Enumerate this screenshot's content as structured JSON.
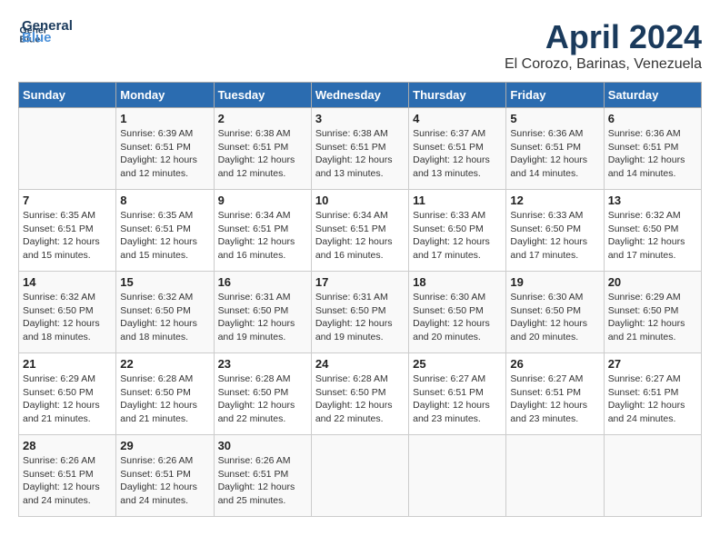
{
  "header": {
    "logo_line1": "General",
    "logo_line2": "Blue",
    "month_title": "April 2024",
    "location": "El Corozo, Barinas, Venezuela"
  },
  "weekdays": [
    "Sunday",
    "Monday",
    "Tuesday",
    "Wednesday",
    "Thursday",
    "Friday",
    "Saturday"
  ],
  "weeks": [
    [
      {
        "day": "",
        "sunrise": "",
        "sunset": "",
        "daylight": ""
      },
      {
        "day": "1",
        "sunrise": "Sunrise: 6:39 AM",
        "sunset": "Sunset: 6:51 PM",
        "daylight": "Daylight: 12 hours and 12 minutes."
      },
      {
        "day": "2",
        "sunrise": "Sunrise: 6:38 AM",
        "sunset": "Sunset: 6:51 PM",
        "daylight": "Daylight: 12 hours and 12 minutes."
      },
      {
        "day": "3",
        "sunrise": "Sunrise: 6:38 AM",
        "sunset": "Sunset: 6:51 PM",
        "daylight": "Daylight: 12 hours and 13 minutes."
      },
      {
        "day": "4",
        "sunrise": "Sunrise: 6:37 AM",
        "sunset": "Sunset: 6:51 PM",
        "daylight": "Daylight: 12 hours and 13 minutes."
      },
      {
        "day": "5",
        "sunrise": "Sunrise: 6:36 AM",
        "sunset": "Sunset: 6:51 PM",
        "daylight": "Daylight: 12 hours and 14 minutes."
      },
      {
        "day": "6",
        "sunrise": "Sunrise: 6:36 AM",
        "sunset": "Sunset: 6:51 PM",
        "daylight": "Daylight: 12 hours and 14 minutes."
      }
    ],
    [
      {
        "day": "7",
        "sunrise": "Sunrise: 6:35 AM",
        "sunset": "Sunset: 6:51 PM",
        "daylight": "Daylight: 12 hours and 15 minutes."
      },
      {
        "day": "8",
        "sunrise": "Sunrise: 6:35 AM",
        "sunset": "Sunset: 6:51 PM",
        "daylight": "Daylight: 12 hours and 15 minutes."
      },
      {
        "day": "9",
        "sunrise": "Sunrise: 6:34 AM",
        "sunset": "Sunset: 6:51 PM",
        "daylight": "Daylight: 12 hours and 16 minutes."
      },
      {
        "day": "10",
        "sunrise": "Sunrise: 6:34 AM",
        "sunset": "Sunset: 6:51 PM",
        "daylight": "Daylight: 12 hours and 16 minutes."
      },
      {
        "day": "11",
        "sunrise": "Sunrise: 6:33 AM",
        "sunset": "Sunset: 6:50 PM",
        "daylight": "Daylight: 12 hours and 17 minutes."
      },
      {
        "day": "12",
        "sunrise": "Sunrise: 6:33 AM",
        "sunset": "Sunset: 6:50 PM",
        "daylight": "Daylight: 12 hours and 17 minutes."
      },
      {
        "day": "13",
        "sunrise": "Sunrise: 6:32 AM",
        "sunset": "Sunset: 6:50 PM",
        "daylight": "Daylight: 12 hours and 17 minutes."
      }
    ],
    [
      {
        "day": "14",
        "sunrise": "Sunrise: 6:32 AM",
        "sunset": "Sunset: 6:50 PM",
        "daylight": "Daylight: 12 hours and 18 minutes."
      },
      {
        "day": "15",
        "sunrise": "Sunrise: 6:32 AM",
        "sunset": "Sunset: 6:50 PM",
        "daylight": "Daylight: 12 hours and 18 minutes."
      },
      {
        "day": "16",
        "sunrise": "Sunrise: 6:31 AM",
        "sunset": "Sunset: 6:50 PM",
        "daylight": "Daylight: 12 hours and 19 minutes."
      },
      {
        "day": "17",
        "sunrise": "Sunrise: 6:31 AM",
        "sunset": "Sunset: 6:50 PM",
        "daylight": "Daylight: 12 hours and 19 minutes."
      },
      {
        "day": "18",
        "sunrise": "Sunrise: 6:30 AM",
        "sunset": "Sunset: 6:50 PM",
        "daylight": "Daylight: 12 hours and 20 minutes."
      },
      {
        "day": "19",
        "sunrise": "Sunrise: 6:30 AM",
        "sunset": "Sunset: 6:50 PM",
        "daylight": "Daylight: 12 hours and 20 minutes."
      },
      {
        "day": "20",
        "sunrise": "Sunrise: 6:29 AM",
        "sunset": "Sunset: 6:50 PM",
        "daylight": "Daylight: 12 hours and 21 minutes."
      }
    ],
    [
      {
        "day": "21",
        "sunrise": "Sunrise: 6:29 AM",
        "sunset": "Sunset: 6:50 PM",
        "daylight": "Daylight: 12 hours and 21 minutes."
      },
      {
        "day": "22",
        "sunrise": "Sunrise: 6:28 AM",
        "sunset": "Sunset: 6:50 PM",
        "daylight": "Daylight: 12 hours and 21 minutes."
      },
      {
        "day": "23",
        "sunrise": "Sunrise: 6:28 AM",
        "sunset": "Sunset: 6:50 PM",
        "daylight": "Daylight: 12 hours and 22 minutes."
      },
      {
        "day": "24",
        "sunrise": "Sunrise: 6:28 AM",
        "sunset": "Sunset: 6:50 PM",
        "daylight": "Daylight: 12 hours and 22 minutes."
      },
      {
        "day": "25",
        "sunrise": "Sunrise: 6:27 AM",
        "sunset": "Sunset: 6:51 PM",
        "daylight": "Daylight: 12 hours and 23 minutes."
      },
      {
        "day": "26",
        "sunrise": "Sunrise: 6:27 AM",
        "sunset": "Sunset: 6:51 PM",
        "daylight": "Daylight: 12 hours and 23 minutes."
      },
      {
        "day": "27",
        "sunrise": "Sunrise: 6:27 AM",
        "sunset": "Sunset: 6:51 PM",
        "daylight": "Daylight: 12 hours and 24 minutes."
      }
    ],
    [
      {
        "day": "28",
        "sunrise": "Sunrise: 6:26 AM",
        "sunset": "Sunset: 6:51 PM",
        "daylight": "Daylight: 12 hours and 24 minutes."
      },
      {
        "day": "29",
        "sunrise": "Sunrise: 6:26 AM",
        "sunset": "Sunset: 6:51 PM",
        "daylight": "Daylight: 12 hours and 24 minutes."
      },
      {
        "day": "30",
        "sunrise": "Sunrise: 6:26 AM",
        "sunset": "Sunset: 6:51 PM",
        "daylight": "Daylight: 12 hours and 25 minutes."
      },
      {
        "day": "",
        "sunrise": "",
        "sunset": "",
        "daylight": ""
      },
      {
        "day": "",
        "sunrise": "",
        "sunset": "",
        "daylight": ""
      },
      {
        "day": "",
        "sunrise": "",
        "sunset": "",
        "daylight": ""
      },
      {
        "day": "",
        "sunrise": "",
        "sunset": "",
        "daylight": ""
      }
    ]
  ]
}
